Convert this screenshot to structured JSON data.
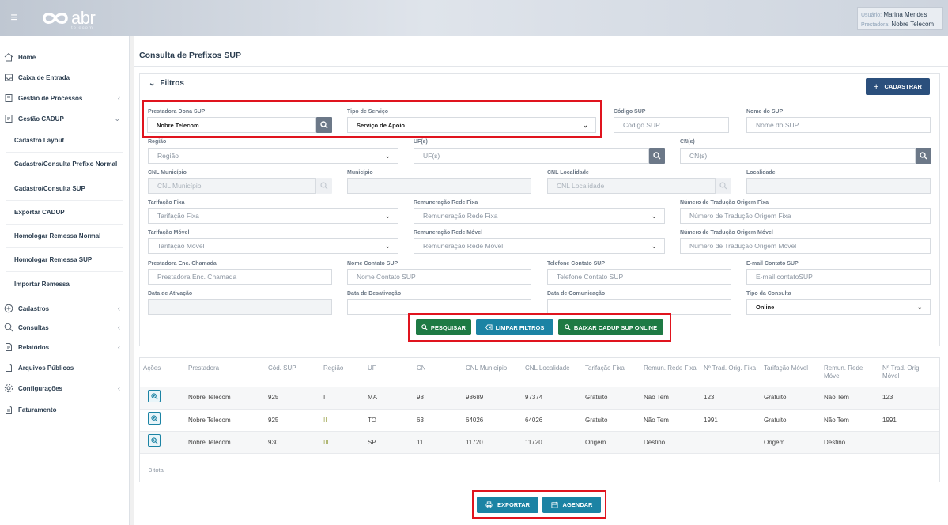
{
  "header": {
    "logo_text": "abr",
    "logo_sub": "telecom",
    "user_label": "Usuário:",
    "user_name": "Marina Mendes",
    "provider_label": "Prestadora:",
    "provider_name": "Nobre Telecom"
  },
  "sidebar": {
    "items": [
      {
        "label": "Home",
        "icon": "home-icon"
      },
      {
        "label": "Caixa de Entrada",
        "icon": "inbox-icon"
      },
      {
        "label": "Gestão de Processos",
        "icon": "process-icon"
      },
      {
        "label": "Gestão CADUP",
        "icon": "document-icon"
      },
      {
        "label": "Cadastros",
        "icon": "plus-circle-icon"
      },
      {
        "label": "Consultas",
        "icon": "search-icon"
      },
      {
        "label": "Relatórios",
        "icon": "report-icon"
      },
      {
        "label": "Arquivos Públicos",
        "icon": "file-icon"
      },
      {
        "label": "Configurações",
        "icon": "gear-icon"
      },
      {
        "label": "Faturamento",
        "icon": "billing-icon"
      }
    ],
    "subitems": [
      "Cadastro Layout",
      "Cadastro/Consulta Prefixo Normal",
      "Cadastro/Consulta SUP",
      "Exportar CADUP",
      "Homologar Remessa Normal",
      "Homologar Remessa SUP",
      "Importar Remessa"
    ]
  },
  "page": {
    "title": "Consulta de Prefixos SUP",
    "filters_title": "Filtros",
    "cadastrar": "CADASTRAR"
  },
  "filters": {
    "prestadora_dona": {
      "label": "Prestadora Dona SUP",
      "value": "Nobre Telecom"
    },
    "tipo_servico": {
      "label": "Tipo de Serviço",
      "value": "Serviço de Apoio"
    },
    "codigo_sup": {
      "label": "Código SUP",
      "placeholder": "Código SUP"
    },
    "nome_sup": {
      "label": "Nome do SUP",
      "placeholder": "Nome do SUP"
    },
    "regiao": {
      "label": "Região",
      "placeholder": "Região"
    },
    "uf": {
      "label": "UF(s)",
      "placeholder": "UF(s)"
    },
    "cn": {
      "label": "CN(s)",
      "placeholder": "CN(s)"
    },
    "cnl_municipio": {
      "label": "CNL Município",
      "placeholder": "CNL Município"
    },
    "municipio": {
      "label": "Município",
      "placeholder": ""
    },
    "cnl_localidade": {
      "label": "CNL Localidade",
      "placeholder": "CNL Localidade"
    },
    "localidade": {
      "label": "Localidade",
      "placeholder": ""
    },
    "tarifacao_fixa": {
      "label": "Tarifação Fixa",
      "placeholder": "Tarifação Fixa"
    },
    "remuneracao_fixa": {
      "label": "Remuneração Rede Fixa",
      "placeholder": "Remuneração Rede Fixa"
    },
    "num_trad_fixa": {
      "label": "Número de Tradução Origem Fixa",
      "placeholder": "Número de Tradução Origem Fixa"
    },
    "tarifacao_movel": {
      "label": "Tarifação Móvel",
      "placeholder": "Tarifação Móvel"
    },
    "remuneracao_movel": {
      "label": "Remuneração Rede Móvel",
      "placeholder": "Remuneração Rede Móvel"
    },
    "num_trad_movel": {
      "label": "Número de Tradução Origem Móvel",
      "placeholder": "Número de Tradução Origem Móvel"
    },
    "prestadora_enc": {
      "label": "Prestadora Enc. Chamada",
      "placeholder": "Prestadora Enc. Chamada"
    },
    "nome_contato": {
      "label": "Nome Contato SUP",
      "placeholder": "Nome Contato SUP"
    },
    "telefone_contato": {
      "label": "Telefone Contato SUP",
      "placeholder": "Telefone Contato SUP"
    },
    "email_contato": {
      "label": "E-mail Contato SUP",
      "placeholder": "E-mail contatoSUP"
    },
    "data_ativacao": {
      "label": "Data de Ativação"
    },
    "data_desativacao": {
      "label": "Data de Desativação"
    },
    "data_comunicacao": {
      "label": "Data de Comunicação"
    },
    "tipo_consulta": {
      "label": "Tipo da Consulta",
      "value": "Online"
    }
  },
  "actions": {
    "pesquisar": "PESQUISAR",
    "limpar": "LIMPAR FILTROS",
    "baixar": "BAIXAR CADUP SUP ONLINE",
    "exportar": "EXPORTAR",
    "agendar": "AGENDAR"
  },
  "table": {
    "headers": [
      "Ações",
      "Prestadora",
      "Cód. SUP",
      "Região",
      "UF",
      "CN",
      "CNL Município",
      "CNL Localidade",
      "Tarifação Fixa",
      "Remun. Rede Fixa",
      "Nº Trad. Orig. Fixa",
      "Tarifação Móvel",
      "Remun. Rede Móvel",
      "Nº Trad. Orig. Móvel"
    ],
    "rows": [
      [
        "Nobre Telecom",
        "925",
        "I",
        "MA",
        "98",
        "98689",
        "97374",
        "Gratuito",
        "Não Tem",
        "123",
        "Gratuito",
        "Não Tem",
        "123"
      ],
      [
        "Nobre Telecom",
        "925",
        "II",
        "TO",
        "63",
        "64026",
        "64026",
        "Gratuito",
        "Não Tem",
        "1991",
        "Gratuito",
        "Não Tem",
        "1991"
      ],
      [
        "Nobre Telecom",
        "930",
        "III",
        "SP",
        "11",
        "11720",
        "11720",
        "Origem",
        "Destino",
        "",
        "Origem",
        "Destino",
        ""
      ]
    ],
    "total": "3 total"
  }
}
